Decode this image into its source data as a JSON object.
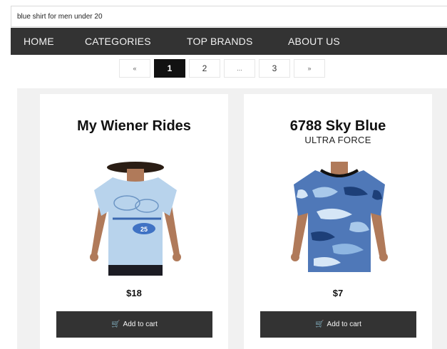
{
  "search": {
    "value": "blue shirt for men under 20"
  },
  "nav": {
    "items": [
      {
        "label": "HOME"
      },
      {
        "label": "CATEGORIES"
      },
      {
        "label": "TOP BRANDS"
      },
      {
        "label": "ABOUT US"
      }
    ]
  },
  "pagination": {
    "prev": "«",
    "pages": [
      "1",
      "2",
      "...",
      "3"
    ],
    "next": "»",
    "current": "1"
  },
  "products": [
    {
      "title": "My Wiener Rides",
      "subtitle": "",
      "price": "$18",
      "button_label": "Add to cart",
      "image": "light-blue-tshirt-with-dog-print",
      "shirt_color": "#b8d3ec"
    },
    {
      "title": "6788 Sky Blue",
      "subtitle": "ULTRA FORCE",
      "price": "$7",
      "button_label": "Add to cart",
      "image": "blue-camo-tshirt",
      "shirt_color": "#4f78b8"
    }
  ],
  "colors": {
    "nav_bg": "#333333",
    "button_bg": "#333333",
    "grid_bg": "#f1f1f1",
    "active_page": "#111111"
  }
}
